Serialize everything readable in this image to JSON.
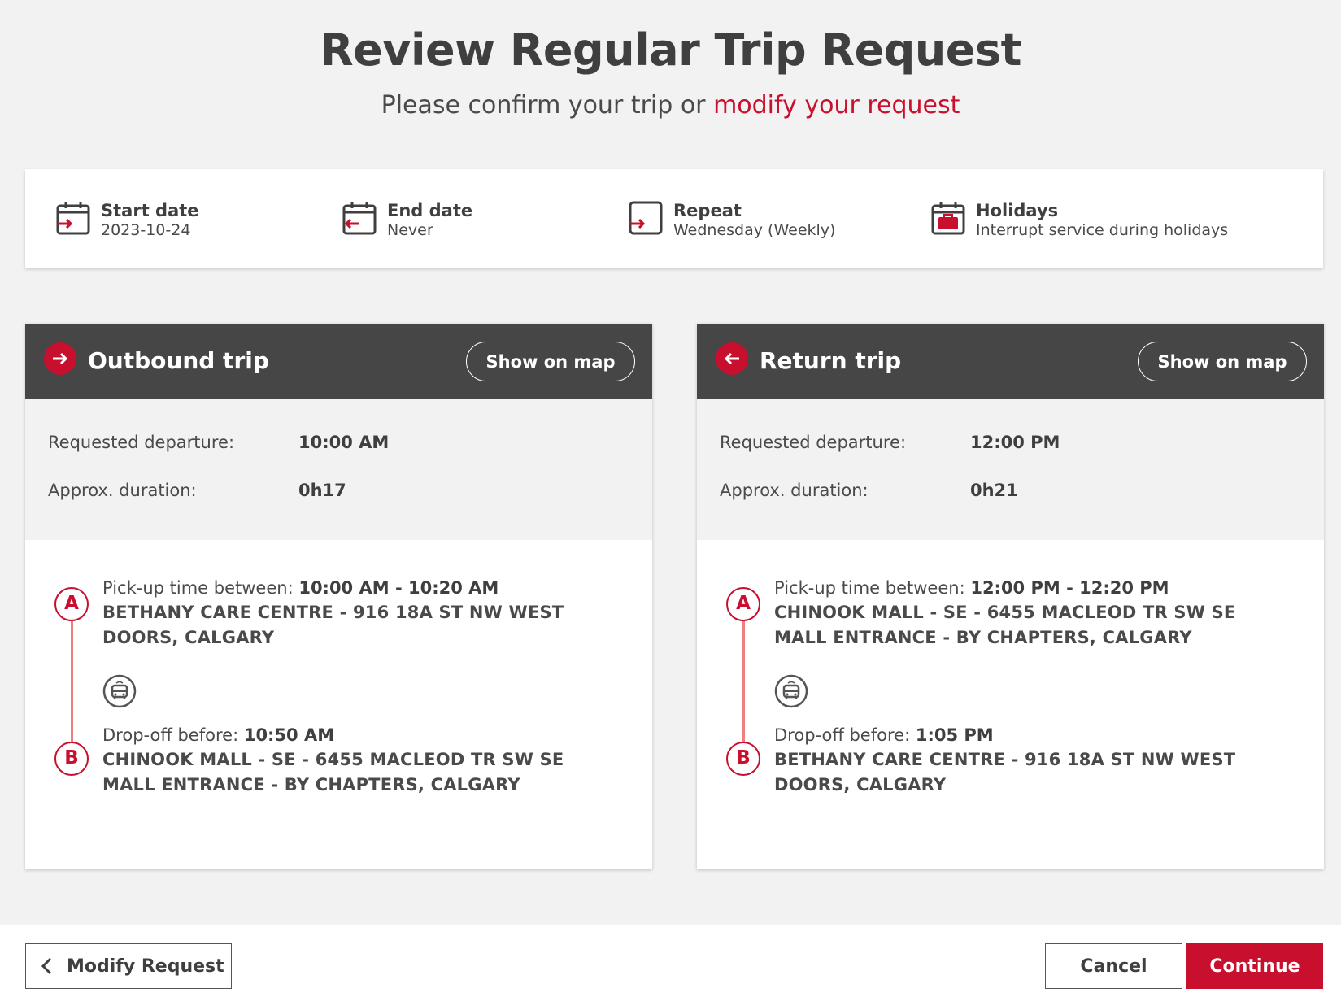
{
  "header": {
    "title": "Review Regular Trip Request",
    "subtitle_prefix": "Please confirm your trip or ",
    "subtitle_link": "modify your request"
  },
  "summary": {
    "start": {
      "label": "Start date",
      "value": "2023-10-24",
      "icon": "calendar-start-icon"
    },
    "end": {
      "label": "End date",
      "value": "Never",
      "icon": "calendar-end-icon"
    },
    "repeat": {
      "label": "Repeat",
      "value": "Wednesday (Weekly)",
      "icon": "repeat-icon"
    },
    "holidays": {
      "label": "Holidays",
      "value": "Interrupt service during holidays",
      "icon": "holiday-calendar-icon"
    }
  },
  "outbound": {
    "title": "Outbound trip",
    "map_button": "Show on map",
    "departure_label": "Requested departure:",
    "departure": "10:00 AM",
    "duration_label": "Approx. duration:",
    "duration": "0h17",
    "pickup_label": "Pick-up time between: ",
    "pickup_time": "10:00 AM - 10:20 AM",
    "pickup_address": "BETHANY CARE CENTRE - 916 18A ST NW WEST DOORS, CALGARY",
    "dropoff_label": "Drop-off before: ",
    "dropoff_time": "10:50 AM",
    "dropoff_address": "CHINOOK MALL - SE - 6455 MACLEOD TR SW SE MALL ENTRANCE - BY CHAPTERS, CALGARY",
    "marker_a": "A",
    "marker_b": "B"
  },
  "return": {
    "title": "Return trip",
    "map_button": "Show on map",
    "departure_label": "Requested departure:",
    "departure": "12:00 PM",
    "duration_label": "Approx. duration:",
    "duration": "0h21",
    "pickup_label": "Pick-up time between: ",
    "pickup_time": "12:00 PM - 12:20 PM",
    "pickup_address": "CHINOOK MALL - SE - 6455 MACLEOD TR SW SE MALL ENTRANCE - BY CHAPTERS, CALGARY",
    "dropoff_label": "Drop-off before: ",
    "dropoff_time": "1:05 PM",
    "dropoff_address": "BETHANY CARE CENTRE - 916 18A ST NW WEST DOORS, CALGARY",
    "marker_a": "A",
    "marker_b": "B"
  },
  "footer": {
    "modify": "Modify Request",
    "cancel": "Cancel",
    "continue": "Continue"
  },
  "colors": {
    "accent": "#c8102e",
    "header_bg": "#464646",
    "route_line": "#f08080"
  }
}
